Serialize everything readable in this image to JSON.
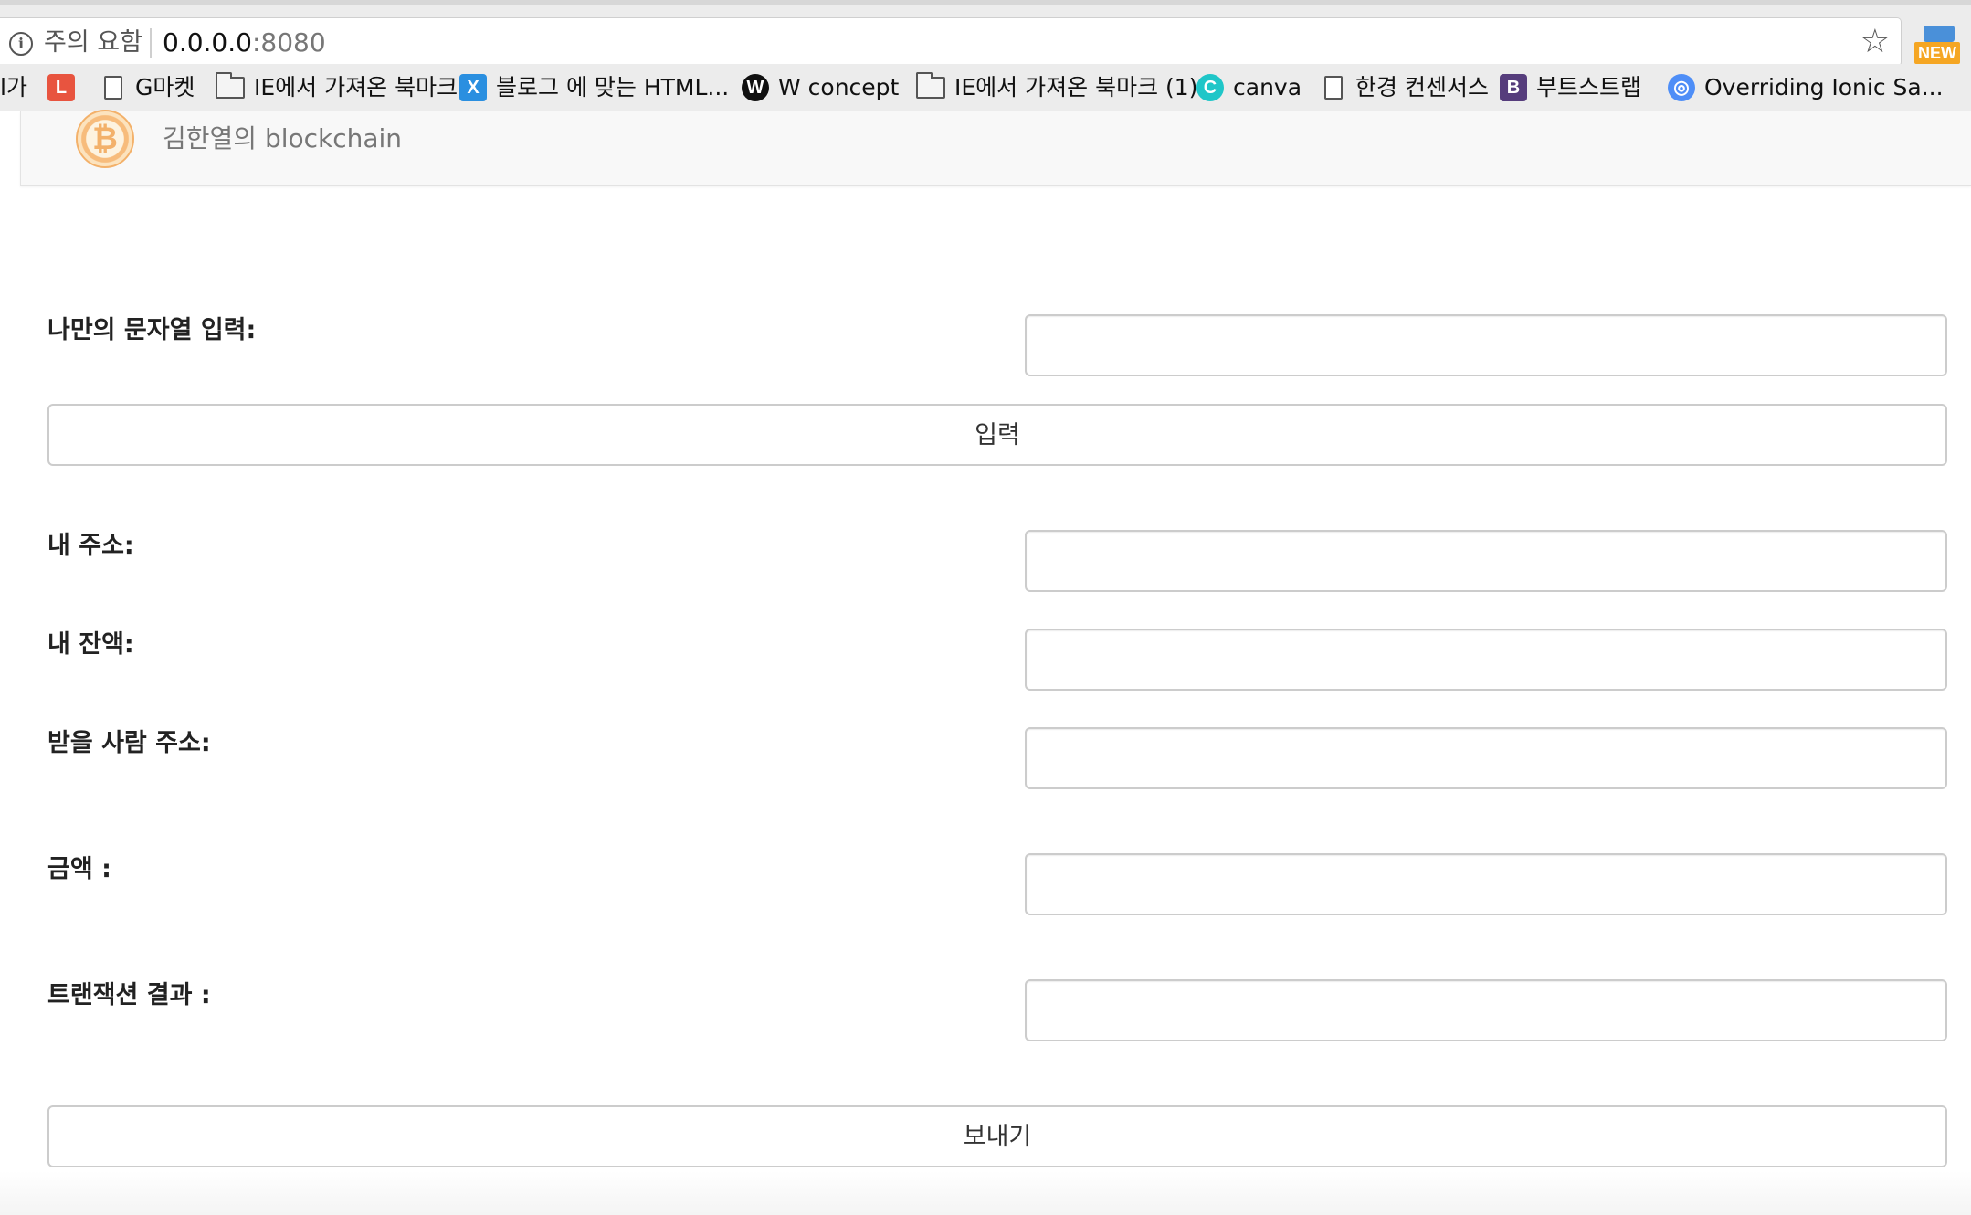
{
  "browser": {
    "security_label": "주의 요함",
    "url_host": "0.0.0.0",
    "url_port": ":8080",
    "extension_badge": "NEW"
  },
  "bookmarks": [
    {
      "label": "l가",
      "icon": "truncated"
    },
    {
      "label": "",
      "icon": "L-app-icon",
      "icon_text": "L",
      "color": "#e8543f"
    },
    {
      "label": "G마켓",
      "icon": "page-icon"
    },
    {
      "label": "IE에서 가져온 북마크",
      "icon": "folder-icon"
    },
    {
      "label": "블로그 에 맞는 HTML...",
      "icon": "x-app-icon",
      "icon_text": "X",
      "color": "#2a8fe0"
    },
    {
      "label": "W concept",
      "icon": "w-concept-icon",
      "icon_text": "W",
      "color": "#111111"
    },
    {
      "label": "IE에서 가져온 북마크 (1)",
      "icon": "folder-icon"
    },
    {
      "label": "canva",
      "icon": "canva-icon",
      "icon_text": "C",
      "color": "#1fc6c8"
    },
    {
      "label": "한경 컨센서스",
      "icon": "page-icon"
    },
    {
      "label": "부트스트랩",
      "icon": "bootstrap-icon",
      "icon_text": "B",
      "color": "#563d7c"
    },
    {
      "label": "Overriding Ionic Sa...",
      "icon": "ionic-icon",
      "icon_text": "◎",
      "color": "#4e8ef7"
    }
  ],
  "navbar": {
    "brand": "김한열의 blockchain",
    "logo_symbol": "₿"
  },
  "form": {
    "custom_string_label": "나만의 문자열 입력:",
    "custom_string_value": "",
    "submit_button": "입력",
    "my_address_label": "내 주소:",
    "my_address_value": "",
    "my_balance_label": "내 잔액:",
    "my_balance_value": "",
    "recipient_label": "받을 사람 주소:",
    "recipient_value": "",
    "amount_label": "금액 :",
    "amount_value": "",
    "tx_result_label": "트랜잭션 결과 :",
    "tx_result_value": "",
    "send_button": "보내기"
  }
}
